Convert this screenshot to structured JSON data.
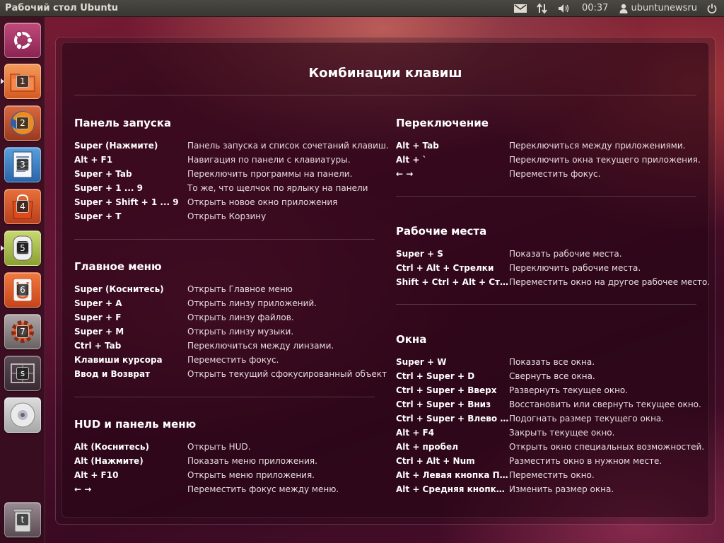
{
  "top_panel": {
    "title": "Рабочий стол Ubuntu",
    "clock": "00:37",
    "user": "ubuntunewsru"
  },
  "launcher": {
    "items": [
      {
        "name": "dash-home",
        "num": ""
      },
      {
        "name": "files",
        "num": "1"
      },
      {
        "name": "firefox",
        "num": "2"
      },
      {
        "name": "libreoffice-writer",
        "num": "3"
      },
      {
        "name": "software-center",
        "num": "4"
      },
      {
        "name": "ubuntu-one",
        "num": "5"
      },
      {
        "name": "ubuntu-one-music",
        "num": "6"
      },
      {
        "name": "system-settings",
        "num": "7"
      },
      {
        "name": "workspace-switcher",
        "num": "s"
      },
      {
        "name": "disc",
        "num": ""
      },
      {
        "name": "trash",
        "num": "t"
      }
    ]
  },
  "overlay": {
    "title": "Комбинации клавиш",
    "sections": {
      "launcher": {
        "title": "Панель запуска",
        "rows": [
          {
            "key": "Super (Нажмите)",
            "desc": "Панель запуска и список сочетаний клавиш."
          },
          {
            "key": "Alt + F1",
            "desc": "Навигация по панели с клавиатуры."
          },
          {
            "key": "Super + Tab",
            "desc": "Переключить программы на панели."
          },
          {
            "key": "Super + 1 ... 9",
            "desc": "То же, что щелчок по ярлыку на панели"
          },
          {
            "key": "Super + Shift + 1 ... 9",
            "desc": "Открыть новое окно приложения"
          },
          {
            "key": "Super + T",
            "desc": "Открыть Корзину"
          }
        ]
      },
      "dash": {
        "title": "Главное меню",
        "rows": [
          {
            "key": "Super (Коснитесь)",
            "desc": "Открыть Главное меню"
          },
          {
            "key": "Super + A",
            "desc": "Открыть линзу приложений."
          },
          {
            "key": "Super + F",
            "desc": "Открыть линзу файлов."
          },
          {
            "key": "Super + M",
            "desc": "Открыть линзу музыки."
          },
          {
            "key": "Ctrl + Tab",
            "desc": "Переключиться между линзами."
          },
          {
            "key": "Клавиши курсора",
            "desc": "Переместить фокус."
          },
          {
            "key": "Ввод и Возврат",
            "desc": "Открыть текущий сфокусированный объект"
          }
        ]
      },
      "hud": {
        "title": "HUD и панель меню",
        "rows": [
          {
            "key": "Alt (Коснитесь)",
            "desc": "Открыть HUD."
          },
          {
            "key": "Alt (Нажмите)",
            "desc": "Показать меню приложения."
          },
          {
            "key": "Alt + F10",
            "desc": "Открыть меню приложения."
          },
          {
            "key": "← →",
            "desc": "Переместить фокус между меню."
          }
        ]
      },
      "switching": {
        "title": "Переключение",
        "rows": [
          {
            "key": "Alt + Tab",
            "desc": "Переключиться между приложениями."
          },
          {
            "key": "Alt + `",
            "desc": "Переключить окна текущего приложения."
          },
          {
            "key": "← →",
            "desc": "Переместить фокус."
          }
        ]
      },
      "workspaces": {
        "title": "Рабочие места",
        "rows": [
          {
            "key": "Super + S",
            "desc": "Показать рабочие места."
          },
          {
            "key": "Ctrl + Alt + Стрелки",
            "desc": "Переключить рабочие места."
          },
          {
            "key": "Shift + Ctrl + Alt + Стре...",
            "desc": "Переместить окно на другое рабочее место."
          }
        ]
      },
      "windows": {
        "title": "Окна",
        "rows": [
          {
            "key": "Super + W",
            "desc": "Показать все окна."
          },
          {
            "key": "Ctrl + Super + D",
            "desc": "Свернуть все окна."
          },
          {
            "key": "Ctrl + Super + Вверх",
            "desc": "Развернуть текущее окно."
          },
          {
            "key": "Ctrl + Super + Вниз",
            "desc": "Восстановить или свернуть текущее окно."
          },
          {
            "key": "Ctrl + Super + Влево ил...",
            "desc": "Подогнать размер текущего окна."
          },
          {
            "key": "Alt + F4",
            "desc": "Закрыть текущее окно."
          },
          {
            "key": "Alt + пробел",
            "desc": "Открыть окно специальных возможностей."
          },
          {
            "key": "Ctrl + Alt + Num",
            "desc": "Разместить окно в нужном месте."
          },
          {
            "key": "Alt + Левая кнопка Пе...",
            "desc": "Переместить окно."
          },
          {
            "key": "Alt + Средняя кнопка ...",
            "desc": "Изменить размер окна."
          }
        ]
      }
    }
  }
}
